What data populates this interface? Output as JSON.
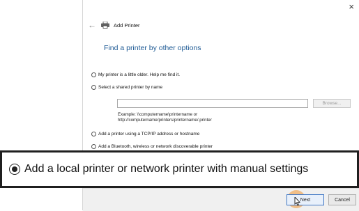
{
  "window": {
    "close_glyph": "×",
    "back_glyph": "←",
    "title": "Add Printer"
  },
  "heading": "Find a printer by other options",
  "options": [
    {
      "label": "My printer is a little older. Help me find it.",
      "selected": false
    },
    {
      "label": "Select a shared printer by name",
      "selected": false
    },
    {
      "label": "Add a printer using a TCP/IP address or hostname",
      "selected": false
    },
    {
      "label": "Add a Bluetooth, wireless or network discoverable printer",
      "selected": false
    }
  ],
  "shared_printer": {
    "value": "",
    "browse_label": "Browse...",
    "example_line1": "Example: \\\\computername\\printername or",
    "example_line2": "http://computername/printers/printername/.printer"
  },
  "highlighted_option": {
    "label": "Add a local printer or network printer with manual settings",
    "selected": true
  },
  "footer": {
    "next_label": "Next",
    "cancel_label": "Cancel"
  },
  "icons": {
    "printer": "printer-icon",
    "back": "back-arrow-icon",
    "close": "close-icon",
    "cursor": "mouse-cursor-icon"
  },
  "colors": {
    "heading": "#1e5a94",
    "next_border": "#3f76c4",
    "click_highlight": "#f09632"
  }
}
